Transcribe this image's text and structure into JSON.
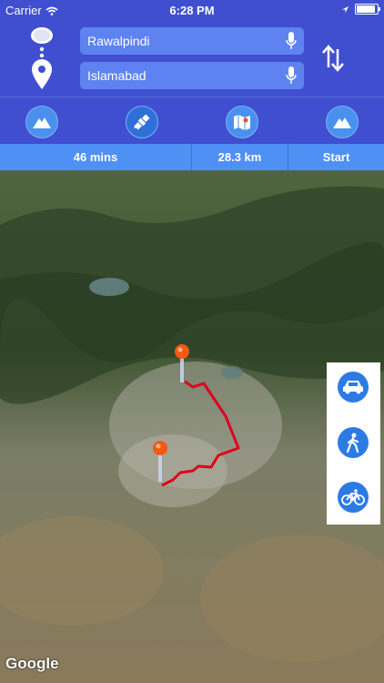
{
  "status_bar": {
    "carrier": "Carrier",
    "time": "6:28 PM"
  },
  "route": {
    "origin": "Rawalpindi",
    "destination": "Islamabad"
  },
  "modes": [
    "terrain-icon",
    "satellite-icon",
    "map-icon",
    "terrain-icon"
  ],
  "info": {
    "duration": "46 mins",
    "distance": "28.3 km",
    "start_label": "Start"
  },
  "map": {
    "attribution": "Google"
  },
  "travel_modes": [
    "car-icon",
    "walk-icon",
    "bicycle-icon"
  ],
  "colors": {
    "header": "#3f4fd0",
    "input": "#5e83f0",
    "info_bar": "#4f90f5",
    "route_line": "#e0001b",
    "travel_mode_button": "#2c7be5"
  }
}
